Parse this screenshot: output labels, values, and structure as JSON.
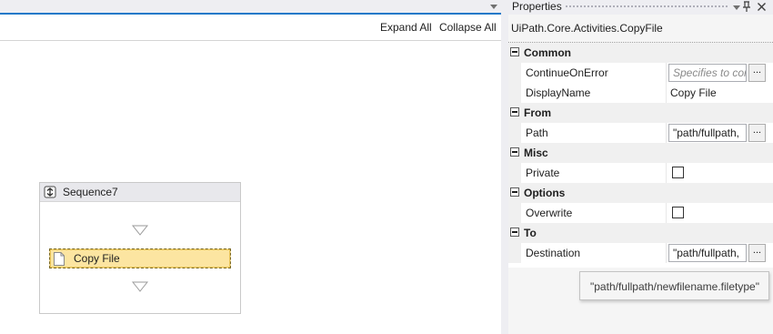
{
  "designer": {
    "toolbar": {
      "expand_all": "Expand All",
      "collapse_all": "Collapse All"
    },
    "sequence": {
      "title": "Sequence7",
      "activity": {
        "label": "Copy File"
      }
    }
  },
  "properties": {
    "title": "Properties",
    "type_name": "UiPath.Core.Activities.CopyFile",
    "categories": {
      "common": {
        "label": "Common",
        "continue_on_error": {
          "name": "ContinueOnError",
          "placeholder": "Specifies to cor"
        },
        "display_name": {
          "name": "DisplayName",
          "value": "Copy File"
        }
      },
      "from": {
        "label": "From",
        "path": {
          "name": "Path",
          "value": "\"path/fullpath,"
        }
      },
      "misc": {
        "label": "Misc",
        "private": {
          "name": "Private",
          "checked": false
        }
      },
      "options": {
        "label": "Options",
        "overwrite": {
          "name": "Overwrite",
          "checked": false
        }
      },
      "to": {
        "label": "To",
        "destination": {
          "name": "Destination",
          "value": "\"path/fullpath,"
        }
      }
    },
    "ellipsis_label": "...",
    "tooltip": "\"path/fullpath/newfilename.filetype\""
  },
  "colors": {
    "accent_line": "#1c79c9",
    "activity_fill": "#fce5a1",
    "panel_bg": "#f5f5f5"
  },
  "icons": [
    "menu-dropdown-icon",
    "sequence-icon",
    "drop-arrow-icon",
    "document-icon",
    "pin-icon",
    "close-icon",
    "collapse-toggle-icon"
  ]
}
